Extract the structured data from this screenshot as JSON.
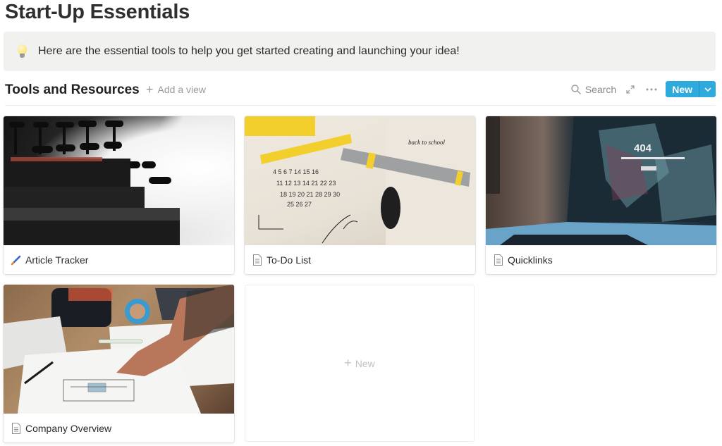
{
  "page": {
    "title": "Start-Up Essentials"
  },
  "callout": {
    "icon": "lightbulb-icon",
    "text": "Here are the essential tools to help you get started creating and launching your idea!"
  },
  "database": {
    "title": "Tools and Resources",
    "add_view_label": "Add a view",
    "toolbar": {
      "search_label": "Search",
      "new_label": "New"
    },
    "accent_color": "#2eaadc"
  },
  "cards": [
    {
      "title": "Article Tracker",
      "icon": "pencil-icon",
      "cover": "typewriter"
    },
    {
      "title": "To-Do List",
      "icon": "page-icon",
      "cover": "calendar-notebook"
    },
    {
      "title": "Quicklinks",
      "icon": "page-icon",
      "cover": "laptop-404"
    },
    {
      "title": "Company Overview",
      "icon": "page-icon",
      "cover": "desk-sketch"
    }
  ],
  "new_card": {
    "label": "New"
  }
}
